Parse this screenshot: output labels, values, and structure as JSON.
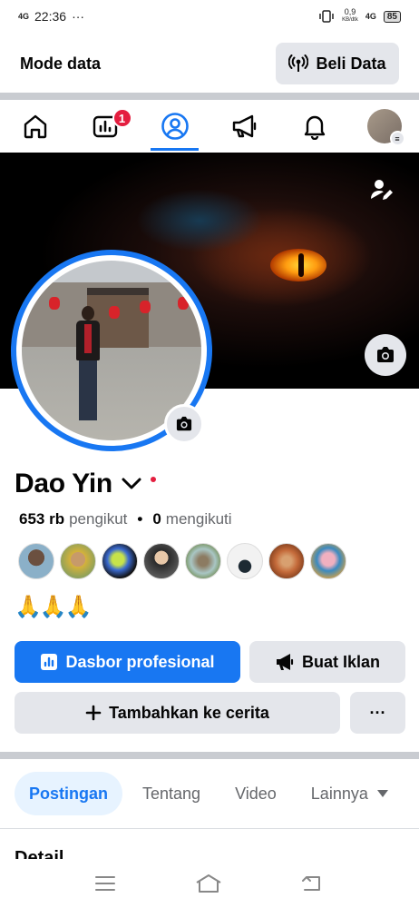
{
  "status_bar": {
    "signal": "4G",
    "time": "22:36",
    "more": "···",
    "speed_value": "0,9",
    "speed_unit": "KB/dtk",
    "network": "4G",
    "battery": "85"
  },
  "data_bar": {
    "title": "Mode data",
    "buy_label": "Beli Data"
  },
  "nav": {
    "tabs": [
      {
        "name": "home",
        "icon": "home-icon"
      },
      {
        "name": "dashboard",
        "icon": "chart-icon",
        "badge": "1"
      },
      {
        "name": "profile",
        "icon": "profile-icon",
        "active": true
      },
      {
        "name": "ads",
        "icon": "megaphone-icon"
      },
      {
        "name": "notifications",
        "icon": "bell-icon"
      },
      {
        "name": "menu",
        "icon": "avatar-menu-icon"
      }
    ]
  },
  "profile": {
    "name": "Dao Yin",
    "followers_count": "653 rb",
    "followers_label": "pengikut",
    "following_count": "0",
    "following_label": "mengikuti",
    "bio_emoji": "🙏🙏🙏"
  },
  "buttons": {
    "dashboard": "Dasbor profesional",
    "ads": "Buat Iklan",
    "add_story": "Tambahkan ke cerita",
    "more": "···"
  },
  "section_tabs": {
    "posts": "Postingan",
    "about": "Tentang",
    "video": "Video",
    "more": "Lainnya"
  },
  "section_heading": "Detail",
  "colors": {
    "accent": "#1877f2",
    "badge": "#e41e3f",
    "button_gray": "#e4e6eb"
  }
}
